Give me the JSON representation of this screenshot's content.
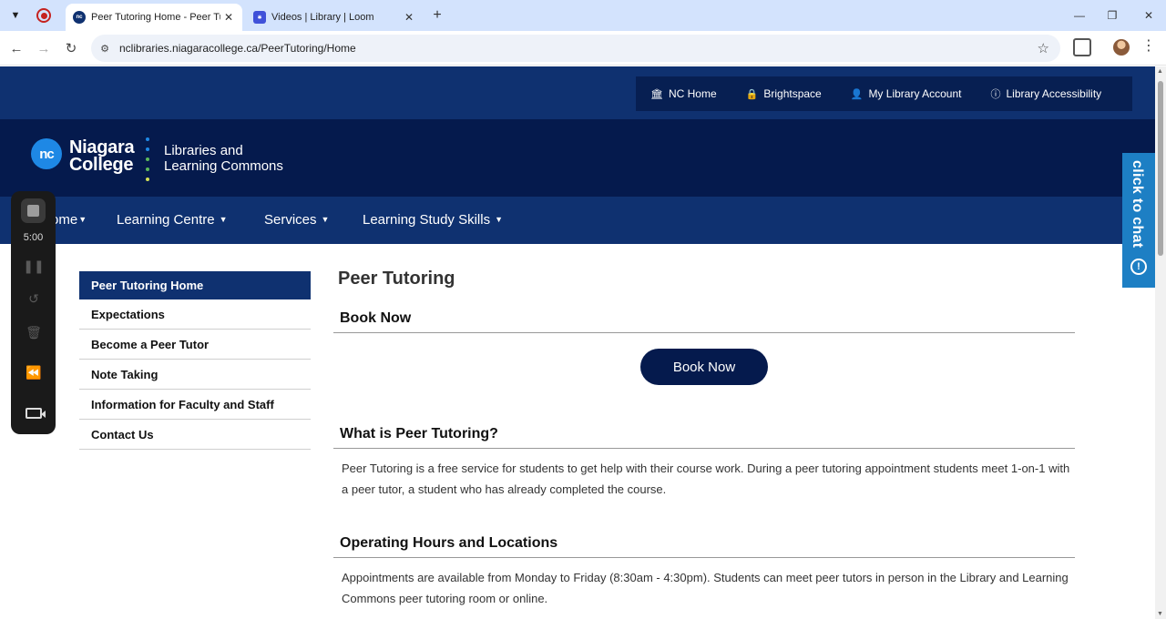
{
  "browser": {
    "tabs": [
      {
        "title": "Peer Tutoring Home - Peer Tutoring",
        "active": true,
        "favicon": "nc-icon"
      },
      {
        "title": "Videos | Library | Loom",
        "active": false,
        "favicon": "loom-icon"
      }
    ],
    "url": "nclibraries.niagaracollege.ca/PeerTutoring/Home"
  },
  "utility": {
    "links": [
      {
        "label": "NC Home",
        "icon": "building-icon"
      },
      {
        "label": "Brightspace",
        "icon": "lock-icon"
      },
      {
        "label": "My Library Account",
        "icon": "user-icon"
      },
      {
        "label": "Library Accessibility",
        "icon": "info-icon"
      }
    ]
  },
  "brand": {
    "logo_initials": "nc",
    "logo_line1": "Niagara",
    "logo_line2": "College",
    "subtitle_line1": "Libraries and",
    "subtitle_line2": "Learning Commons",
    "dot_colors": [
      "#1e88e5",
      "#1e88e5",
      "#5cb85c",
      "#5cb85c",
      "#d4e157"
    ]
  },
  "nav": {
    "items": [
      {
        "label": "ome"
      },
      {
        "label": "Learning Centre"
      },
      {
        "label": "Services"
      },
      {
        "label": "Learning Study Skills"
      }
    ]
  },
  "sidebar": {
    "items": [
      {
        "label": "Peer Tutoring Home",
        "active": true
      },
      {
        "label": "Expectations"
      },
      {
        "label": "Become a Peer Tutor"
      },
      {
        "label": "Note Taking"
      },
      {
        "label": "Information for Faculty and Staff"
      },
      {
        "label": "Contact Us"
      }
    ]
  },
  "content": {
    "title": "Peer Tutoring",
    "book_heading": "Book Now",
    "book_button": "Book Now",
    "what_heading": "What is Peer Tutoring?",
    "what_text": "Peer Tutoring is a free service for students to get help with their course work. During a peer tutoring appointment students meet 1-on-1 with a peer tutor, a student who has already completed the course.",
    "hours_heading": "Operating Hours and Locations",
    "hours_text": "Appointments are available from Monday to Friday (8:30am - 4:30pm). Students can meet peer tutors in person in the Library and Learning Commons peer tutoring room or online."
  },
  "chat": {
    "label": "click to chat"
  },
  "recorder": {
    "time": "5:00"
  },
  "colors": {
    "utility_bg": "#0f3170",
    "brand_bg": "#051a4d",
    "accent_blue": "#1d7fc4",
    "tab_strip": "#d3e3fd"
  }
}
